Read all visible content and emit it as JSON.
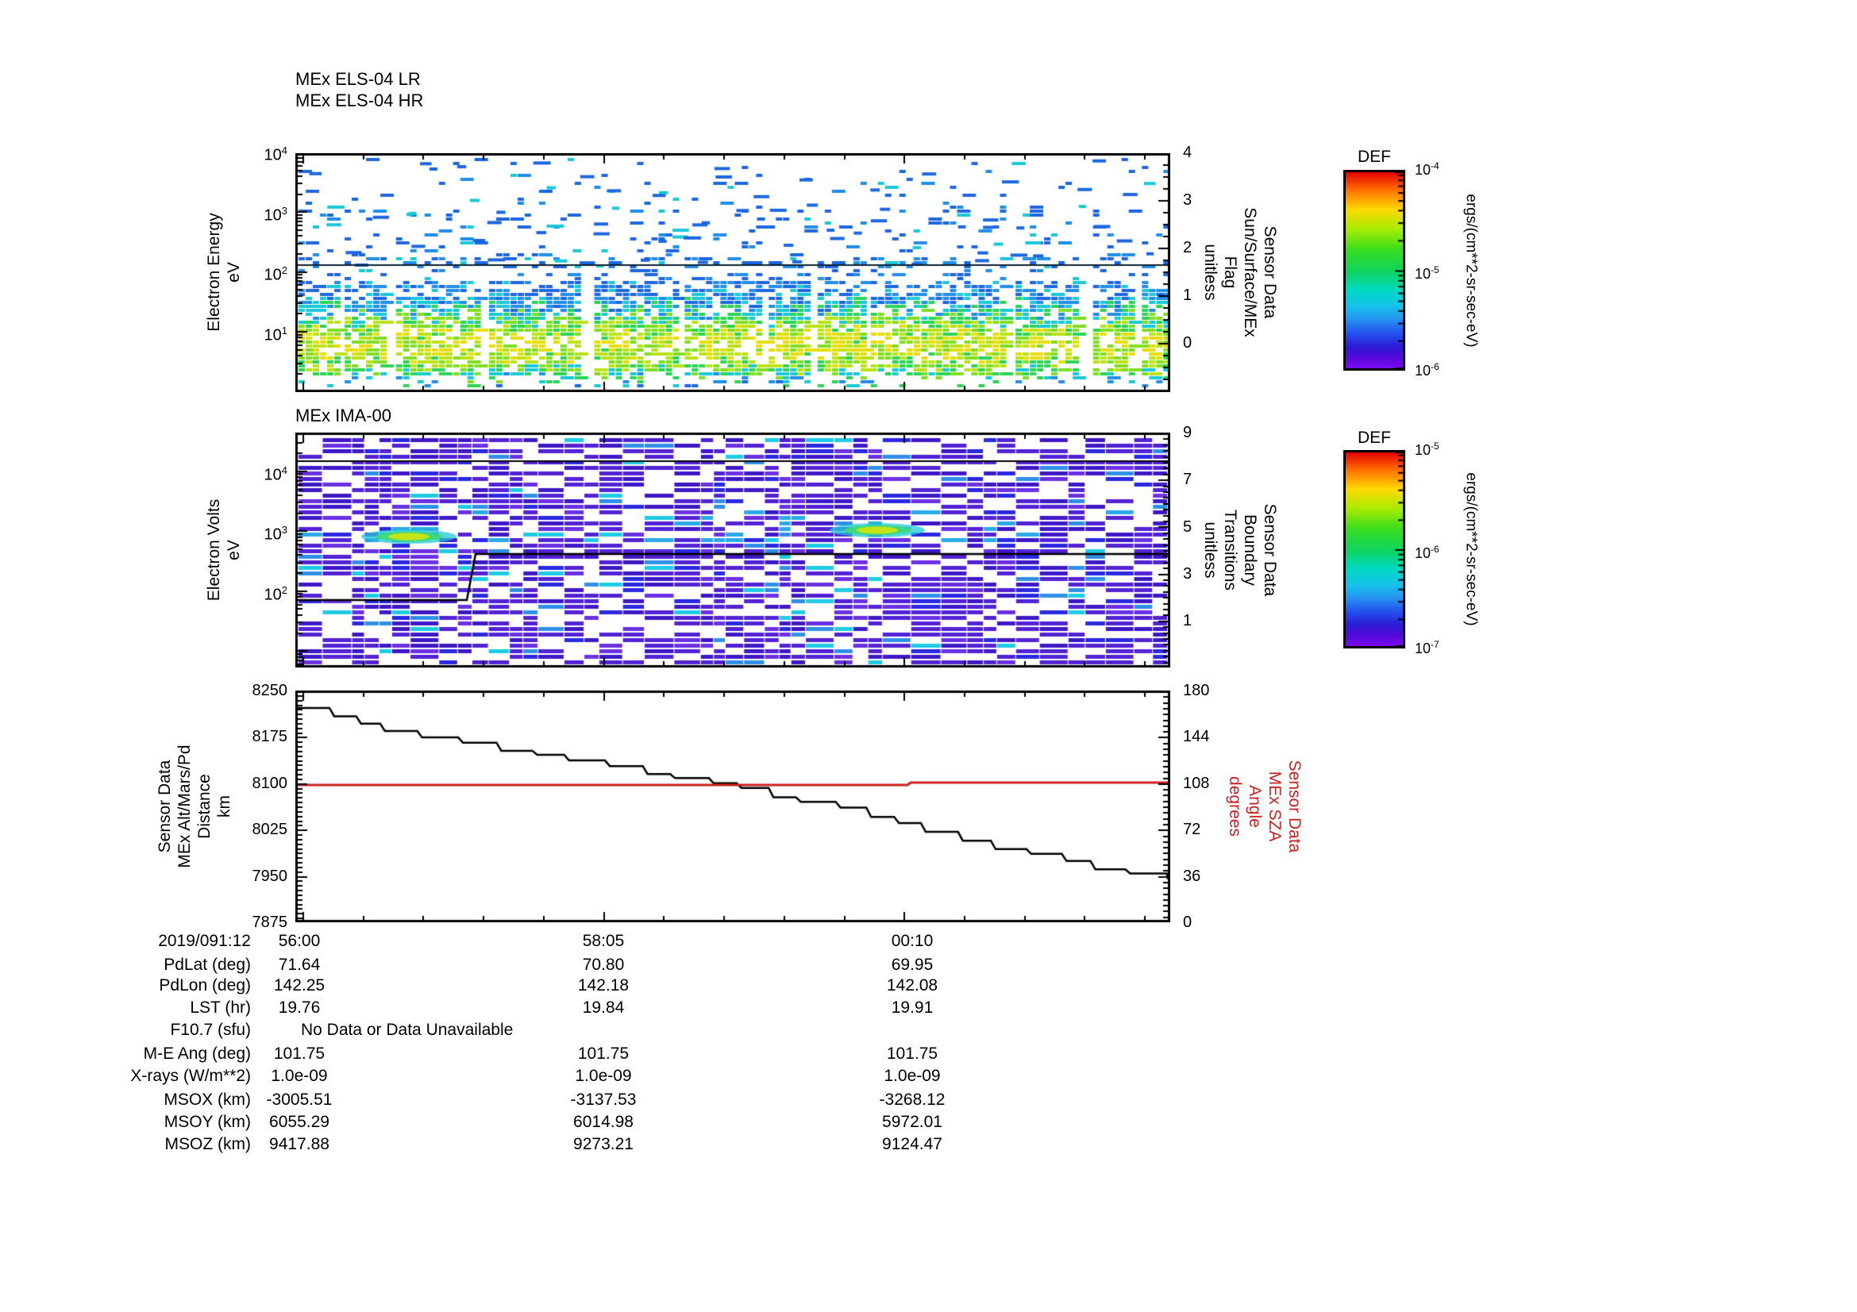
{
  "header": {
    "els_title_lines": [
      "MEx ELS-04 LR",
      "MEx ELS-04 HR"
    ],
    "ima_title": "MEx IMA-00"
  },
  "plots": {
    "els": {
      "left_label_lines": [
        "Electron Energy",
        "eV"
      ],
      "left_ticks": [
        "10^4",
        "10^3",
        "10^2",
        "10^1"
      ],
      "right_label_lines": [
        "Sensor Data",
        "Sun/Surface/MEx",
        "Flag",
        "unitless"
      ],
      "right_ticks": [
        "4",
        "3",
        "2",
        "1",
        "0"
      ]
    },
    "ima": {
      "left_label_lines": [
        "Electron Volts",
        "eV"
      ],
      "left_ticks": [
        "10^4",
        "10^3",
        "10^2"
      ],
      "right_label_lines": [
        "Sensor Data",
        "Boundary",
        "Transitions",
        "unitless"
      ],
      "right_ticks": [
        "9",
        "7",
        "5",
        "3",
        "1"
      ]
    },
    "alt": {
      "left_label_lines": [
        "Sensor Data",
        "MEx Alt/Mars/Pd",
        "Distance",
        "km"
      ],
      "left_ticks": [
        "8250",
        "8175",
        "8100",
        "8025",
        "7950",
        "7875"
      ],
      "right_label_lines": [
        "Sensor Data",
        "MEx SZA",
        "Angle",
        "degrees"
      ],
      "right_ticks": [
        "180",
        "144",
        "108",
        "72",
        "36",
        "0"
      ],
      "right_label_color": "#cc2020"
    }
  },
  "colorbars": [
    {
      "title": "DEF",
      "ticks": [
        "10^-4",
        "10^-5",
        "10^-6"
      ],
      "unit": "ergs/(cm**2-sr-sec-eV)"
    },
    {
      "title": "DEF",
      "ticks": [
        "10^-5",
        "10^-6",
        "10^-7"
      ],
      "unit": "ergs/(cm**2-sr-sec-eV)"
    }
  ],
  "xaxis": {
    "date_label": "2019/091:12",
    "ticks": [
      "56:00",
      "58:05",
      "00:10"
    ]
  },
  "table": {
    "rows": [
      {
        "label": "PdLat (deg)",
        "values": [
          "71.64",
          "70.80",
          "69.95"
        ]
      },
      {
        "label": "PdLon (deg)",
        "values": [
          "142.25",
          "142.18",
          "142.08"
        ]
      },
      {
        "label": "LST (hr)",
        "values": [
          "19.76",
          "19.84",
          "19.91"
        ]
      },
      {
        "label": "F10.7 (sfu)",
        "note": "No Data or Data Unavailable"
      },
      {
        "label": "M-E Ang (deg)",
        "values": [
          "101.75",
          "101.75",
          "101.75"
        ]
      },
      {
        "label": "X-rays (W/m**2)",
        "values": [
          "1.0e-09",
          "1.0e-09",
          "1.0e-09"
        ]
      },
      {
        "label": "MSOX (km)",
        "values": [
          "-3005.51",
          "-3137.53",
          "-3268.12"
        ]
      },
      {
        "label": "MSOY (km)",
        "values": [
          "6055.29",
          "6014.98",
          "5972.01"
        ]
      },
      {
        "label": "MSOZ (km)",
        "values": [
          "9417.88",
          "9273.21",
          "9124.47"
        ]
      }
    ]
  },
  "chart_data": [
    {
      "type": "heatmap",
      "title": "MEx ELS-04 LR / MEx ELS-04 HR",
      "ylabel": "Electron Energy (eV)",
      "y_scale": "log",
      "y_range": [
        1,
        10000
      ],
      "x_ticks": [
        "56:00",
        "58:05",
        "00:10"
      ],
      "x_start_label": "2019/091:12 56:00",
      "right_axis": {
        "label": "Sensor Data Sun/Surface/MEx Flag (unitless)",
        "range": [
          -1,
          4
        ],
        "major_ticks": [
          0,
          1,
          2,
          3,
          4
        ]
      },
      "colorbar": {
        "title": "DEF",
        "units": "ergs/(cm**2-sr-sec-eV)",
        "range_log10": [
          -6,
          -4
        ]
      },
      "description": "Sparse blue/cyan dashes above ~200 eV; dense blue/green/yellow-green flux band between ~3 and ~100 eV; vertical white data gaps; thin dark flag line near 160 eV."
    },
    {
      "type": "heatmap",
      "title": "MEx IMA-00",
      "ylabel": "Electron Volts (eV)",
      "y_scale": "log",
      "y_range": [
        5,
        30000
      ],
      "x_ticks": [
        "56:00",
        "58:05",
        "00:10"
      ],
      "right_axis": {
        "label": "Sensor Data Boundary Transitions (unitless)",
        "range": [
          -1,
          9
        ],
        "major_ticks": [
          1,
          3,
          5,
          7,
          9
        ]
      },
      "colorbar": {
        "title": "DEF",
        "units": "ergs/(cm**2-sr-sec-eV)",
        "range_log10": [
          -7,
          -5
        ]
      },
      "overlay_lines": {
        "top_line_eV": 15000,
        "boundary_transition_steps": [
          {
            "x_fraction": 0.0,
            "value": 2.0
          },
          {
            "x_fraction": 0.2,
            "value": 3.8
          }
        ]
      },
      "description": "Dense violet/indigo/blue mosaic over full energy range with ~35% white gaps; two yellow-green/cyan hotspots near 1000 eV at ~13% and ~66% of the time axis."
    },
    {
      "type": "line",
      "x_ticks": [
        "56:00",
        "58:05",
        "00:10"
      ],
      "x_minor_interval_s": 25,
      "y_left": {
        "label": "Sensor Data MEx Alt/Mars/Pd Distance (km)",
        "range": [
          7875,
          8250
        ],
        "major_step": 75
      },
      "y_right": {
        "label": "Sensor Data MEx SZA Angle (degrees)",
        "range": [
          0,
          180
        ],
        "major_step": 36,
        "color": "#cc2020"
      },
      "series": [
        {
          "name": "MEx Alt/Mars/Pd Distance",
          "axis": "left",
          "style": "stepped-decreasing",
          "color": "#000000",
          "start_km": 8222,
          "end_km": 7925
        },
        {
          "name": "MEx SZA Angle",
          "axis": "right",
          "style": "flat-with-small-step",
          "color": "#cc2020",
          "value_before_deg": 107.0,
          "value_after_deg": 108.0,
          "step_x_fraction": 0.7
        }
      ]
    }
  ],
  "colors": {
    "accent_red": "#cc2020",
    "spectro_blue": "#1b66e0",
    "spectro_cyan": "#17c9d6",
    "spectro_green": "#2ad455",
    "spectro_yellow": "#e6de07",
    "ima_violet": "#5222d4",
    "ima_indigo": "#3f18c6",
    "ima_blue": "#2a28e0"
  }
}
